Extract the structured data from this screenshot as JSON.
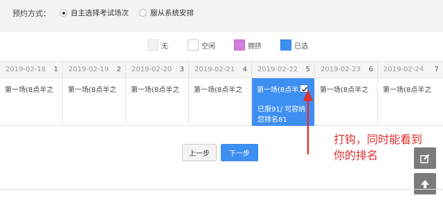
{
  "booking": {
    "label": "预约方式：",
    "option_self": "自主选择考试场次",
    "option_system": "服从系统安排"
  },
  "legend": {
    "none": "无",
    "free": "空闲",
    "crowded": "拥挤",
    "chosen": "已选"
  },
  "dates": [
    {
      "date": "2019-02-18",
      "num": "1"
    },
    {
      "date": "2019-02-19",
      "num": "2"
    },
    {
      "date": "2019-02-20",
      "num": "3"
    },
    {
      "date": "2019-02-21",
      "num": "4"
    },
    {
      "date": "2019-02-22",
      "num": "5"
    },
    {
      "date": "2019-02-23",
      "num": "6"
    },
    {
      "date": "2019-02-24",
      "num": "7"
    }
  ],
  "slots": [
    {
      "text": "第一场(8点半之"
    },
    {
      "text": "第一场(8点半之"
    },
    {
      "text": "第一场(8点半之"
    },
    {
      "text": "第一场(8点半之"
    },
    {
      "text": "第一场(8点半之",
      "info1": "已报91/ 可容纳",
      "info2": "您排名81"
    },
    {
      "text": "第一场(8点半之"
    },
    {
      "text": "第一场(8点半之"
    }
  ],
  "buttons": {
    "prev": "上一步",
    "next": "下一步"
  },
  "annotation": {
    "line1": "打钩，同时能看到",
    "line2": "你的排名"
  },
  "colors": {
    "selected": "#3e8ff2",
    "crowded": "#d27ddc",
    "annotation": "#e03030"
  },
  "icons": {
    "edit": "edit-icon",
    "scroll_top": "arrow-up-icon",
    "check": "check-icon"
  }
}
